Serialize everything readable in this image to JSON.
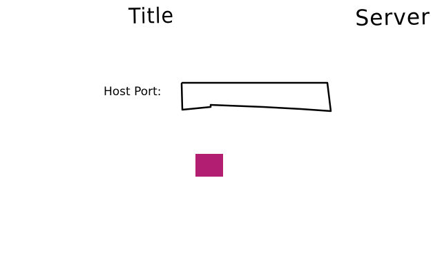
{
  "header": {
    "title": "Title",
    "server": "Server"
  },
  "form": {
    "host_port_label": "Host Port:",
    "host_port_value": "",
    "host_port_placeholder": ""
  },
  "action_button": {
    "label": "",
    "color": "#b21e72"
  }
}
